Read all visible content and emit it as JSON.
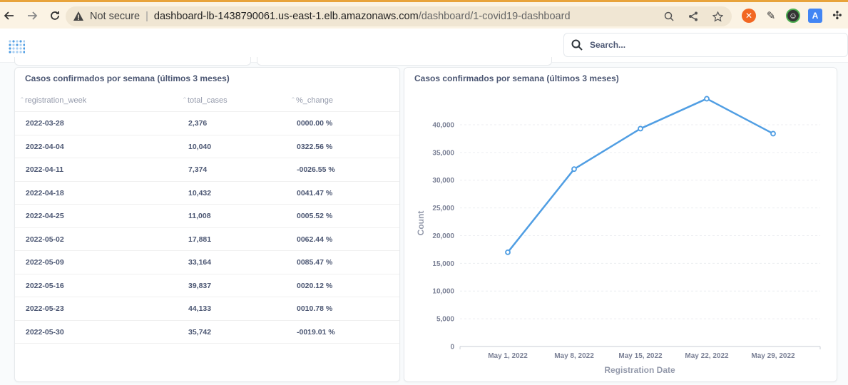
{
  "browser": {
    "not_secure_label": "Not secure",
    "url_host": "dashboard-lb-1438790061.us-east-1.elb.amazonaws.com",
    "url_path": "/dashboard/1-covid19-dashboard"
  },
  "header": {
    "search_placeholder": "Search..."
  },
  "table_card": {
    "title": "Casos confirmados por semana (últimos 3 meses)",
    "columns": [
      "registration_week",
      "total_cases",
      "%_change"
    ],
    "rows": [
      [
        "2022-03-28",
        "2,376",
        "0000.00 %"
      ],
      [
        "2022-04-04",
        "10,040",
        "0322.56 %"
      ],
      [
        "2022-04-11",
        "7,374",
        "-0026.55 %"
      ],
      [
        "2022-04-18",
        "10,432",
        "0041.47 %"
      ],
      [
        "2022-04-25",
        "11,008",
        "0005.52 %"
      ],
      [
        "2022-05-02",
        "17,881",
        "0062.44 %"
      ],
      [
        "2022-05-09",
        "33,164",
        "0085.47 %"
      ],
      [
        "2022-05-16",
        "39,837",
        "0020.12 %"
      ],
      [
        "2022-05-23",
        "44,133",
        "0010.78 %"
      ],
      [
        "2022-05-30",
        "35,742",
        "-0019.01 %"
      ]
    ]
  },
  "chart_card": {
    "title": "Casos confirmados por semana (últimos 3 meses)"
  },
  "chart_data": {
    "type": "line",
    "title": "Casos confirmados por semana (últimos 3 meses)",
    "xlabel": "Registration Date",
    "ylabel": "Count",
    "x": [
      "May 1, 2022",
      "May 8, 2022",
      "May 15, 2022",
      "May 22, 2022",
      "May 29, 2022"
    ],
    "values": [
      17000,
      32000,
      39300,
      44700,
      38400
    ],
    "ylim": [
      0,
      40000
    ],
    "yticks": [
      "0",
      "5,000",
      "10,000",
      "15,000",
      "20,000",
      "25,000",
      "30,000",
      "35,000",
      "40,000"
    ],
    "grid": true,
    "color": "#509ee3"
  }
}
